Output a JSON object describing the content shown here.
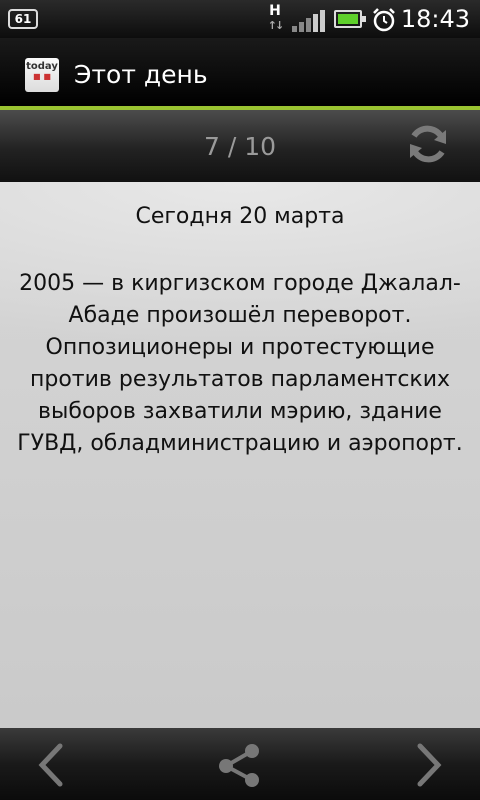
{
  "statusbar": {
    "notification_count": "61",
    "network_type": "H",
    "time": "18:43"
  },
  "app": {
    "icon_label": "today",
    "title": "Этот день"
  },
  "counter": {
    "text": "7 / 10"
  },
  "content": {
    "date": "Сегодня 20 марта",
    "event": "2005 — в киргизском городе Джалал-Абаде произошёл переворот. Оппозиционеры и протестующие против результатов парламентских выборов захватили мэрию, здание ГУВД, обладминистрацию и аэропорт."
  },
  "colors": {
    "accent": "#9ac331",
    "battery": "#5fd02b"
  },
  "icons": {
    "refresh": "refresh-icon",
    "prev": "chevron-left-icon",
    "share": "share-icon",
    "next": "chevron-right-icon",
    "alarm": "alarm-clock-icon"
  }
}
